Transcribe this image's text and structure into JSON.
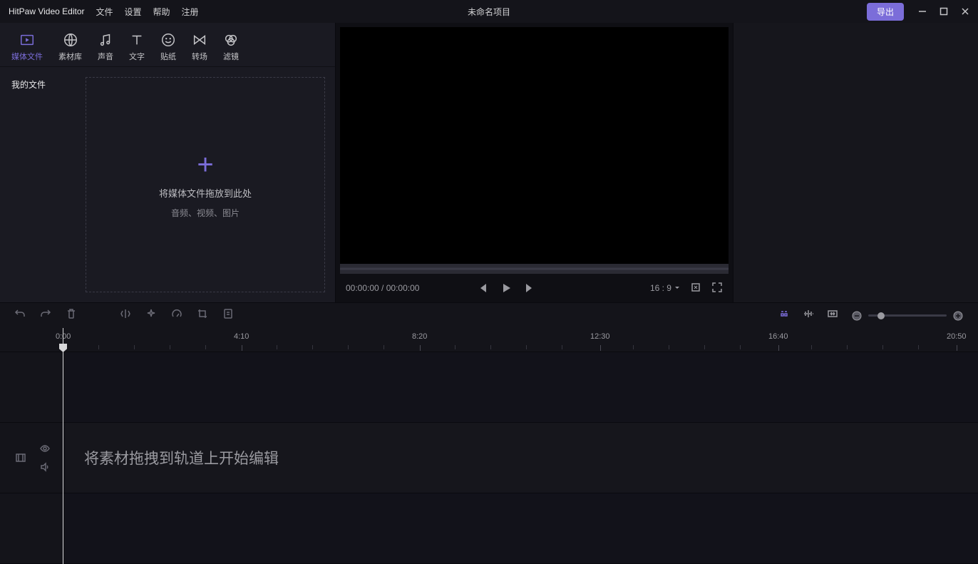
{
  "app": {
    "name": "HitPaw Video Editor"
  },
  "menu": {
    "file": "文件",
    "settings": "设置",
    "help": "帮助",
    "register": "注册"
  },
  "project": {
    "title": "未命名项目"
  },
  "titlebar": {
    "export": "导出"
  },
  "mediaTabs": [
    {
      "label": "媒体文件",
      "icon": "play-box"
    },
    {
      "label": "素材库",
      "icon": "globe"
    },
    {
      "label": "声音",
      "icon": "music"
    },
    {
      "label": "文字",
      "icon": "text"
    },
    {
      "label": "贴纸",
      "icon": "smile"
    },
    {
      "label": "转场",
      "icon": "transition"
    },
    {
      "label": "滤镜",
      "icon": "filter"
    }
  ],
  "mediaSidebar": {
    "myFiles": "我的文件"
  },
  "dropzone": {
    "line1": "将媒体文件拖放到此处",
    "line2": "音频、视频、图片"
  },
  "preview": {
    "currentTime": "00:00:00",
    "totalTime": "00:00:00",
    "timeSeparator": " / ",
    "aspect": "16 : 9"
  },
  "timeline": {
    "ruler": [
      "0:00",
      "4:10",
      "8:20",
      "12:30",
      "16:40",
      "20:50"
    ],
    "hint": "将素材拖拽到轨道上开始编辑"
  }
}
